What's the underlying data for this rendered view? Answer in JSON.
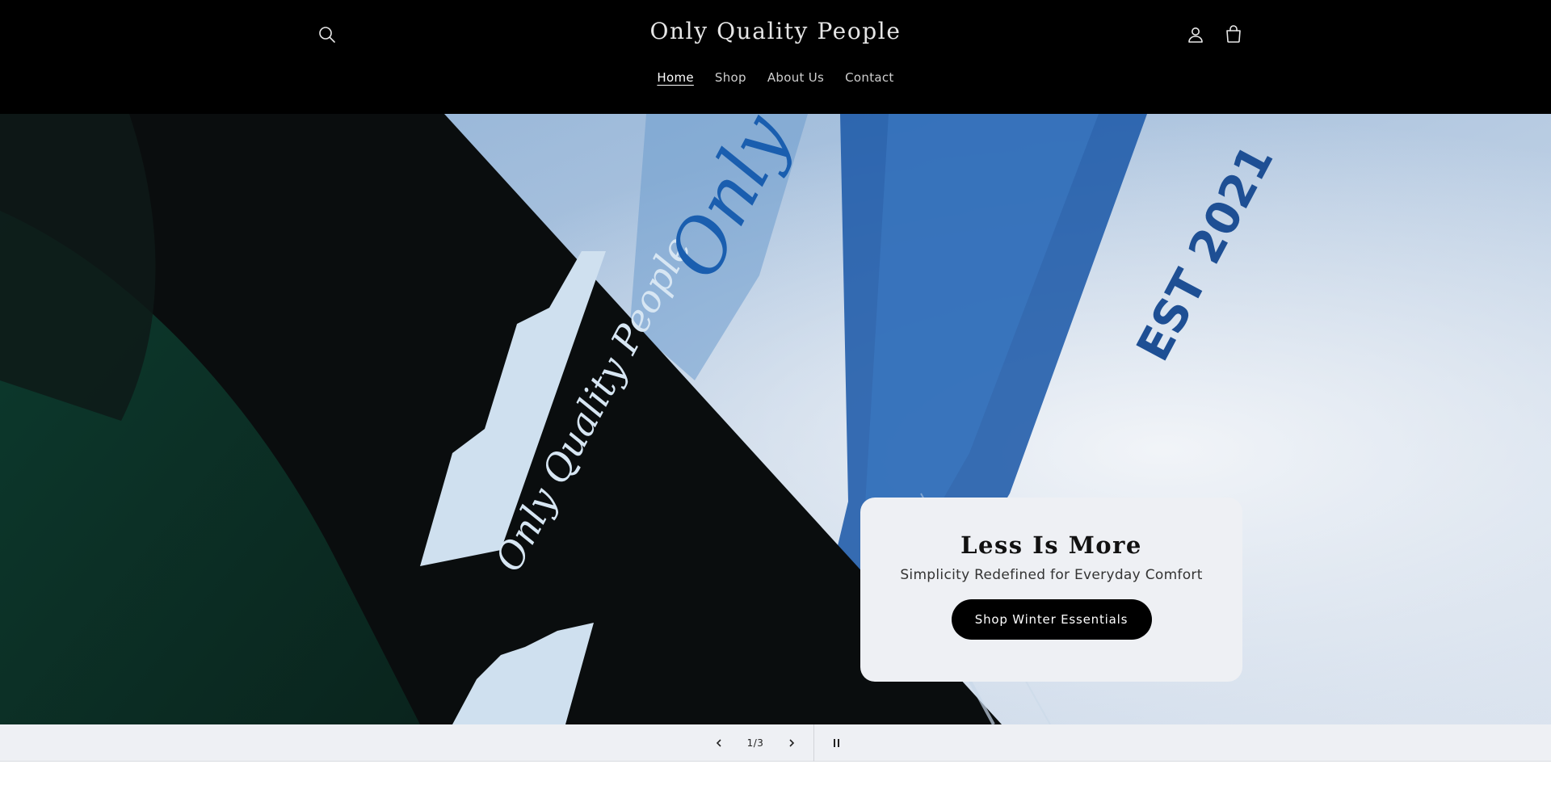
{
  "header": {
    "logo": "Only Quality People",
    "icons": {
      "search": "search-icon",
      "account": "account-icon",
      "cart": "cart-icon"
    },
    "nav": [
      {
        "label": "Home",
        "active": true
      },
      {
        "label": "Shop",
        "active": false
      },
      {
        "label": "About Us",
        "active": false
      },
      {
        "label": "Contact",
        "active": false
      }
    ]
  },
  "hero": {
    "image_text": {
      "script_lower": "Only Quality People",
      "script_upper": "Only",
      "est": "EST 2021"
    },
    "card": {
      "title": "Less Is More",
      "subtitle": "Simplicity Redefined for Everyday Comfort",
      "button": "Shop Winter Essentials"
    }
  },
  "slideshow": {
    "counter": "1/3",
    "icons": {
      "prev": "chevron-left-icon",
      "next": "chevron-right-icon",
      "pause": "pause-icon"
    }
  },
  "colors": {
    "header_bg": "#000000",
    "card_bg": "#eef0f4",
    "accent": "#000000"
  }
}
